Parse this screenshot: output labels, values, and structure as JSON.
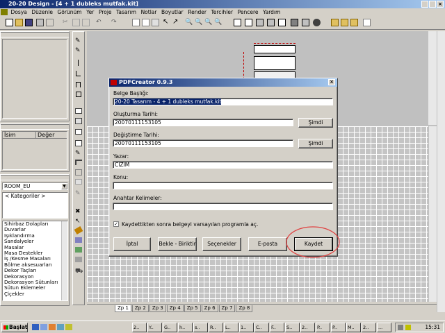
{
  "window": {
    "title": "20-20 Design - [4 + 1 dubleks mutfak.kit]"
  },
  "menu": [
    "Dosya",
    "Düzenle",
    "Görünüm",
    "Yer",
    "Proje",
    "Tasarım",
    "Notlar",
    "Boyutlar",
    "Render",
    "Tercihler",
    "Pencere",
    "Yardım"
  ],
  "props": {
    "col_name": "İsim",
    "col_value": "Değer"
  },
  "room_select": "ROOM_EU",
  "catalog": {
    "header": "< Kategoriler >",
    "items": [
      "Sihirbaz Dolapları",
      "Duvarlar",
      "Işıklandırma",
      "Sandalyeler",
      "Masalar",
      "Masa Destekler",
      "İş /Kesme Masaları",
      "Bölme aksesuarları",
      "Dekor Taçları",
      "Dekorasyon",
      "Dekorasyon Sütunları",
      "Sütun Eklemeler",
      "Çiçekler"
    ]
  },
  "tabs": [
    "Zp 1",
    "Zp 2",
    "Zp 3",
    "Zp 4",
    "Zp 5",
    "Zp 6",
    "Zp 7",
    "Zp 8"
  ],
  "dialog": {
    "title": "PDFCreator 0.9.3",
    "doc_title_label": "Belge Başlığı:",
    "doc_title_value": "20-20 Tasarım - 4 + 1 dubleks mutfak.kit",
    "created_label": "Oluşturma Tarihi:",
    "created_value": "20070111153105",
    "modified_label": "Değiştirme Tarihi:",
    "modified_value": "20070111153105",
    "now_button": "Şimdi",
    "author_label": "Yazar:",
    "author_value": "CIZIM",
    "subject_label": "Konu:",
    "subject_value": "",
    "keywords_label": "Anahtar Kelimeler:",
    "keywords_value": "",
    "save_default_label": "Kaydettikten sonra belgeyi varsayılan programla aç.",
    "save_default_checked": true,
    "buttons": {
      "cancel": "İptal",
      "wait": "Bekle - Biriktir",
      "options": "Seçenekler",
      "email": "E-posta",
      "save": "Kaydet"
    }
  },
  "taskbar": {
    "start": "Başlat",
    "tasks": [
      "2..",
      "Y..",
      "G..",
      "h..",
      "s..",
      "R..",
      "L..",
      "1..",
      "C..",
      "F..",
      "S..",
      "2..",
      "P..",
      "P..",
      "M..",
      "2..",
      "..."
    ],
    "clock": "15:31"
  }
}
